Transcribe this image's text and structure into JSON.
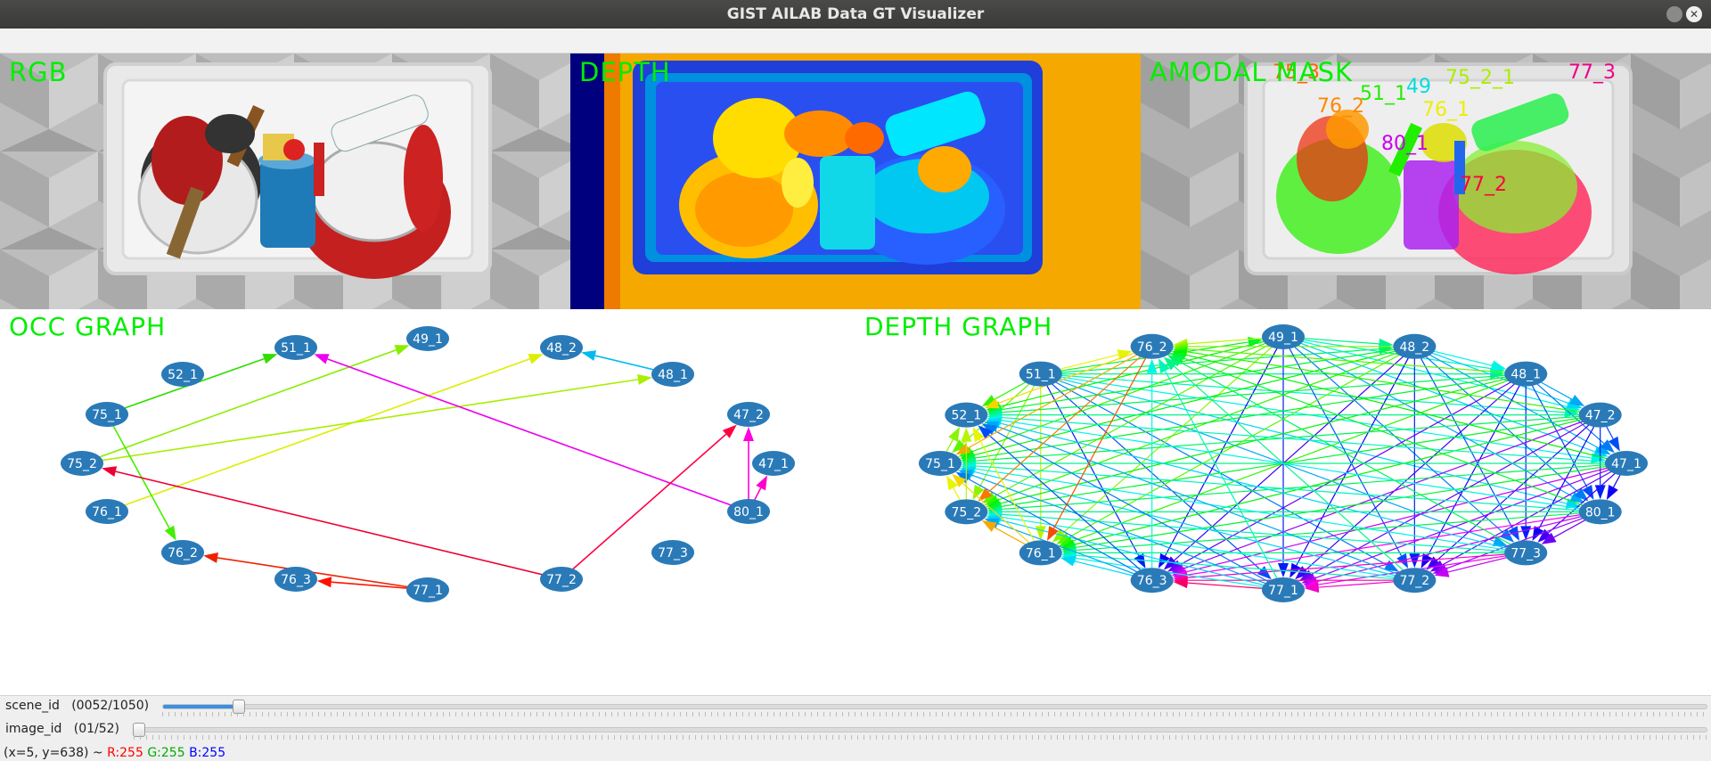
{
  "window": {
    "title": "GIST AILAB Data GT Visualizer",
    "close_glyph": "✕"
  },
  "panels": {
    "rgb_label": "RGB",
    "depth_label": "DEPTH",
    "amodal_label": "AMODAL MASK",
    "occ_graph_label": "OCC GRAPH",
    "depth_graph_label": "DEPTH GRAPH"
  },
  "nodes": [
    "51_1",
    "49_1",
    "48_2",
    "48_1",
    "47_2",
    "47_1",
    "80_1",
    "77_3",
    "77_2",
    "77_1",
    "76_3",
    "76_2",
    "76_1",
    "75_2",
    "75_1",
    "52_1"
  ],
  "occ_graph": {
    "edges": [
      {
        "from": "75_1",
        "to": "51_1",
        "color": "#33dd00"
      },
      {
        "from": "75_2",
        "to": "49_1",
        "color": "#88ee00"
      },
      {
        "from": "76_1",
        "to": "48_2",
        "color": "#ddee00"
      },
      {
        "from": "75_2",
        "to": "48_1",
        "color": "#aaee00"
      },
      {
        "from": "48_1",
        "to": "48_2",
        "color": "#00bbee"
      },
      {
        "from": "80_1",
        "to": "51_1",
        "color": "#ee00ee"
      },
      {
        "from": "75_1",
        "to": "76_2",
        "color": "#44ee00"
      },
      {
        "from": "77_2",
        "to": "75_2",
        "color": "#ee0033"
      },
      {
        "from": "77_2",
        "to": "47_2",
        "color": "#ff0044"
      },
      {
        "from": "80_1",
        "to": "47_2",
        "color": "#ff00dd"
      },
      {
        "from": "80_1",
        "to": "47_1",
        "color": "#ff00cc"
      },
      {
        "from": "77_1",
        "to": "76_2",
        "color": "#ee2200"
      },
      {
        "from": "77_1",
        "to": "76_3",
        "color": "#ff1100"
      }
    ]
  },
  "amodal_labels": [
    {
      "text": "75_3",
      "color": "#ff6600"
    },
    {
      "text": "76_2",
      "color": "#ff8800"
    },
    {
      "text": "51_1",
      "color": "#22ee00"
    },
    {
      "text": "49",
      "color": "#00dddd"
    },
    {
      "text": "75_2_1",
      "color": "#aaee00"
    },
    {
      "text": "76_1",
      "color": "#eeee00"
    },
    {
      "text": "80_1",
      "color": "#cc00ee"
    },
    {
      "text": "77_2",
      "color": "#ff0044"
    },
    {
      "text": "77_3",
      "color": "#ee0088"
    }
  ],
  "status": {
    "scene_label": "scene_id   (0052/1050)",
    "scene_value": 0.049,
    "image_label": "image_id   (01/52)",
    "image_value": 0.0,
    "pixel_coords": "(x=5, y=638) ~",
    "r_text": "R:255",
    "g_text": "G:255",
    "b_text": "B:255",
    "r_color": "#ff0000",
    "g_color": "#00aa00",
    "b_color": "#0000ff"
  }
}
